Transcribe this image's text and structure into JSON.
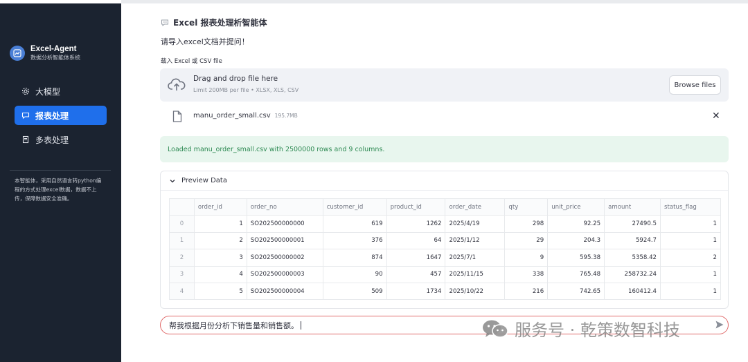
{
  "sidebar": {
    "brand_title": "Excel-Agent",
    "brand_subtitle": "数据分析智能体系统",
    "items": [
      {
        "label": "大模型",
        "icon": "gear-icon",
        "active": false
      },
      {
        "label": "报表处理",
        "icon": "chat-bubble-icon",
        "active": true
      },
      {
        "label": "多表处理",
        "icon": "document-icon",
        "active": false
      }
    ],
    "note": "本智能体，采用自然语言转python编程的方式处理excel数据，数据不上传，保障数据安全准确。"
  },
  "main": {
    "title_icon": "speech-bubble-icon",
    "title": "Excel 报表处理析智能体",
    "prompt": "请导入excel文档并提问！",
    "upload_label": "载入 Excel 或 CSV file",
    "dropzone": {
      "main_text": "Drag and drop file here",
      "sub_text": "Limit 200MB per file • XLSX, XLS, CSV",
      "browse_label": "Browse files"
    },
    "file": {
      "name": "manu_order_small.csv",
      "size": "195.7MB",
      "close": "✕"
    },
    "success_message": "Loaded manu_order_small.csv with 2500000 rows and 9 columns.",
    "preview": {
      "label": "Preview Data",
      "columns": [
        "",
        "order_id",
        "order_no",
        "customer_id",
        "product_id",
        "order_date",
        "qty",
        "unit_price",
        "amount",
        "status_flag"
      ],
      "rows": [
        [
          "0",
          "1",
          "SO202500000000",
          "619",
          "1262",
          "2025/4/19",
          "298",
          "92.25",
          "27490.5",
          "1"
        ],
        [
          "1",
          "2",
          "SO202500000001",
          "376",
          "64",
          "2025/1/12",
          "29",
          "204.3",
          "5924.7",
          "1"
        ],
        [
          "2",
          "3",
          "SO202500000002",
          "874",
          "1647",
          "2025/7/1",
          "9",
          "595.38",
          "5358.42",
          "2"
        ],
        [
          "3",
          "4",
          "SO202500000003",
          "90",
          "457",
          "2025/11/15",
          "338",
          "765.48",
          "258732.24",
          "1"
        ],
        [
          "4",
          "5",
          "SO202500000004",
          "509",
          "1734",
          "2025/10/22",
          "216",
          "742.65",
          "160412.4",
          "1"
        ]
      ]
    },
    "chat_input": "帮我根据月份分析下销售量和销售额。",
    "watermark": "服务号 · 乾策数智科技"
  },
  "colors": {
    "sidebar_bg": "#1b2330",
    "accent": "#1f6feb",
    "success_bg": "#e8f6ee",
    "success_text": "#2e8a53",
    "chat_border": "#e06a6a"
  }
}
